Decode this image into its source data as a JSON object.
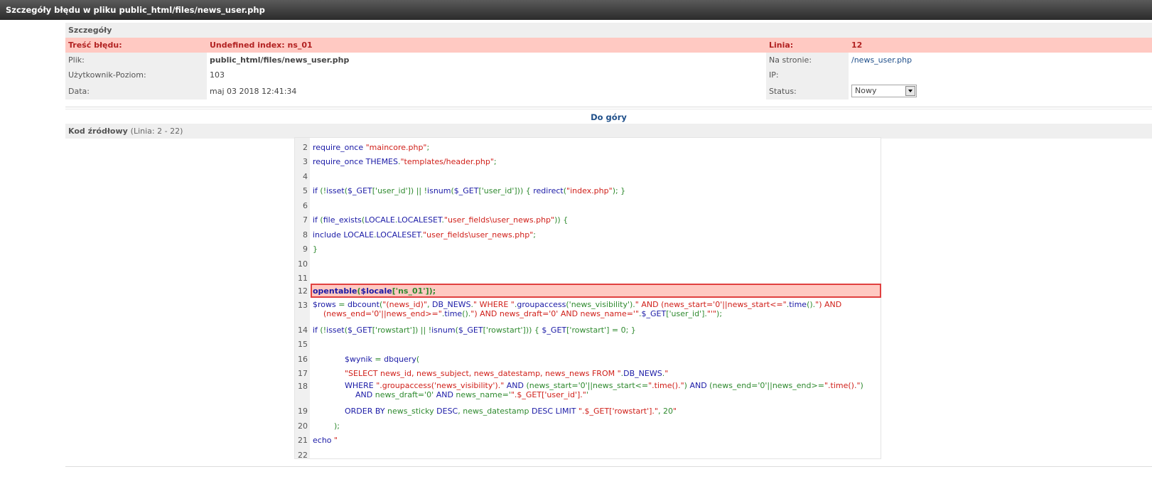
{
  "window": {
    "title": "Szczegóły błędu w pliku public_html/files/news_user.php"
  },
  "details": {
    "heading": "Szczegóły",
    "error_label": "Treść błędu:",
    "error_value": "Undefined index: ns_01",
    "line_label": "Linia:",
    "line_value": "12",
    "file_label": "Plik:",
    "file_value": "public_html/files/news_user.php",
    "page_label": "Na stronie:",
    "page_value": "/news_user.php",
    "user_label": "Użytkownik-Poziom:",
    "user_value": "103",
    "ip_label": "IP:",
    "ip_value": "",
    "date_label": "Data:",
    "date_value": "maj 03 2018 12:41:34",
    "status_label": "Status:",
    "status_value": "Nowy"
  },
  "nav": {
    "top_link": "Do góry"
  },
  "source": {
    "heading": "Kod źródłowy",
    "range": "(Linia: 2 - 22)",
    "line_numbers": [
      "2",
      "3",
      "4",
      "5",
      "6",
      "7",
      "8",
      "9",
      "10",
      "11",
      "12",
      "13",
      "14",
      "15",
      "16",
      "17",
      "18",
      "19",
      "20",
      "21",
      "22"
    ],
    "lines": [
      "require_once \"maincore.php\";",
      "require_once THEMES.\"templates/header.php\";",
      "",
      "if (!isset($_GET['user_id']) || !isnum($_GET['user_id'])) { redirect(\"index.php\"); }",
      "",
      "if (file_exists(LOCALE.LOCALESET.\"user_fields\\user_news.php\")) {",
      "include LOCALE.LOCALESET.\"user_fields\\user_news.php\";",
      "}",
      "",
      "",
      "opentable($locale['ns_01']);",
      "$rows = dbcount(\"(news_id)\", DB_NEWS.\" WHERE \".groupaccess('news_visibility').\" AND (news_start='0'||news_start<=\".time().\") AND (news_end='0'||news_end>=\".time().\") AND news_draft='0' AND news_name='\".$_GET['user_id'].\"'\");",
      "if (!isset($_GET['rowstart']) || !isnum($_GET['rowstart'])) { $_GET['rowstart'] = 0; }",
      "",
      "$wynik = dbquery(",
      "\"SELECT news_id, news_subject, news_datestamp, news_news FROM \".DB_NEWS.\"",
      "WHERE \".groupaccess('news_visibility').\" AND (news_start='0'||news_start<=\".time().\") AND (news_end='0'||news_end>=\".time().\") AND news_draft='0' AND news_name='\".$_GET['user_id'].\"'",
      "ORDER BY news_sticky DESC, news_datestamp DESC LIMIT \".$_GET['rowstart'].\", 20\"",
      ");",
      "echo \"",
      ""
    ],
    "highlight_line": "12"
  },
  "colors": {
    "titlebar": "#3a3a3a",
    "error_bg": "#ffc9c2",
    "error_text": "#b22222",
    "link": "#1f4f8a",
    "code_keyword": "#1a1aa6",
    "code_string": "#d0201a",
    "code_default": "#2f8a2f"
  }
}
